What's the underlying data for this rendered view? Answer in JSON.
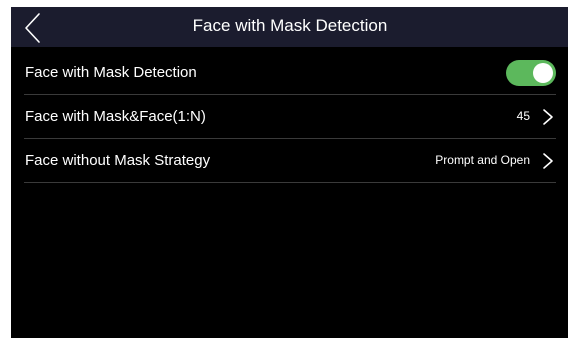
{
  "header": {
    "title": "Face with Mask Detection",
    "back_icon": "chevron-left-icon"
  },
  "settings": [
    {
      "label": "Face with Mask Detection",
      "control": "toggle",
      "toggle_on": true,
      "toggle_color": "#5cb85c"
    },
    {
      "label": "Face with Mask&Face(1:N)",
      "value": "45",
      "control": "chevron",
      "icon": "chevron-right-icon"
    },
    {
      "label": "Face without Mask Strategy",
      "value": "Prompt and Open",
      "control": "chevron",
      "icon": "chevron-right-icon"
    }
  ],
  "colors": {
    "header_bg": "#1b1c2e",
    "screen_bg": "#000000",
    "divider": "#3a3a3a",
    "text": "#ffffff"
  }
}
